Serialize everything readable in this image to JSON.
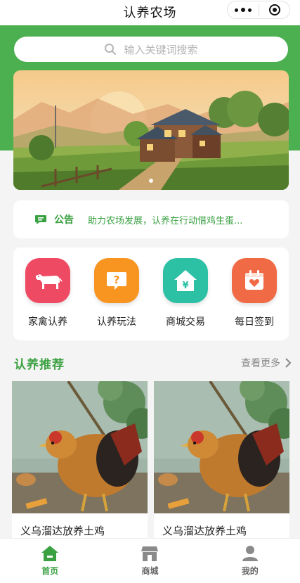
{
  "app": {
    "title": "认养农场"
  },
  "colors": {
    "brand": "#4caf50",
    "accent_text": "#3aa142"
  },
  "search": {
    "placeholder": "输入关键词搜索",
    "icon": "search-icon"
  },
  "notice": {
    "label": "公告",
    "text": "助力农场发展，认养在行动借鸡生蛋...",
    "icon": "message-icon"
  },
  "quick_menu": [
    {
      "label": "家禽认养",
      "icon": "cow-icon",
      "color": "#ef4a63"
    },
    {
      "label": "认养玩法",
      "icon": "question-icon",
      "color": "#f89420"
    },
    {
      "label": "商城交易",
      "icon": "shop-house-icon",
      "color": "#2cc0a5"
    },
    {
      "label": "每日签到",
      "icon": "calendar-heart-icon",
      "color": "#f06a45"
    }
  ],
  "recommend": {
    "title": "认养推荐",
    "more": "查看更多",
    "items": [
      {
        "name": "义乌溜达放养土鸡"
      },
      {
        "name": "义乌溜达放养土鸡"
      }
    ]
  },
  "tabbar": [
    {
      "label": "首页",
      "icon": "home-icon",
      "active": true
    },
    {
      "label": "商城",
      "icon": "store-icon",
      "active": false
    },
    {
      "label": "我的",
      "icon": "user-icon",
      "active": false
    }
  ]
}
